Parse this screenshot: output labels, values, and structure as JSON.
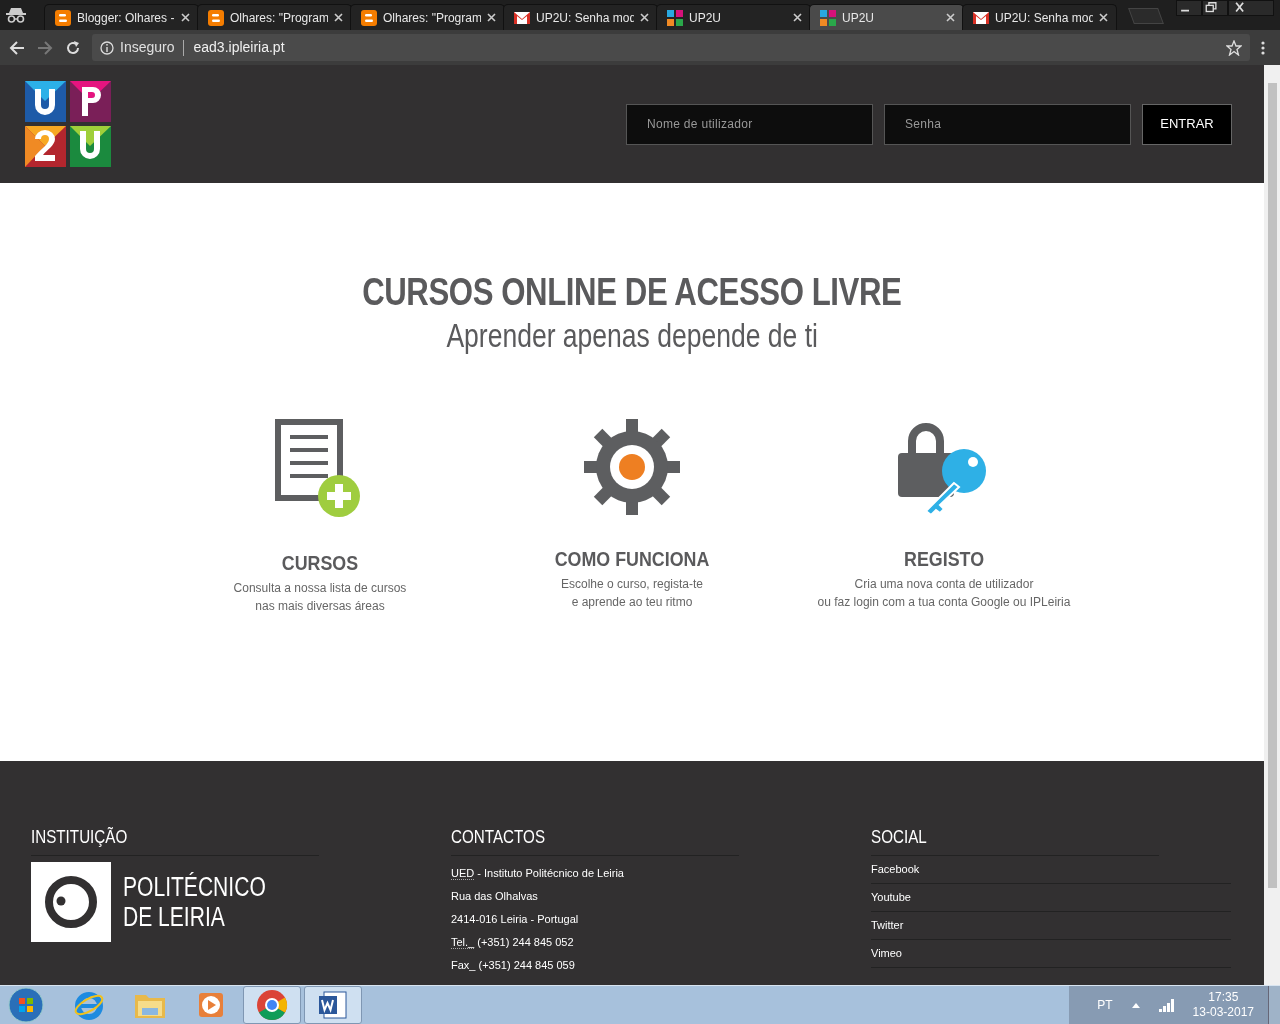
{
  "browser": {
    "tabs": [
      {
        "title": "Blogger: Olhares -",
        "kind": "blogger",
        "selected": false
      },
      {
        "title": "Olhares: \"Program",
        "kind": "blogger",
        "selected": false
      },
      {
        "title": "Olhares: \"Program",
        "kind": "blogger",
        "selected": false
      },
      {
        "title": "UP2U: Senha mod",
        "kind": "gmail",
        "selected": false
      },
      {
        "title": "UP2U",
        "kind": "up2u",
        "selected": false
      },
      {
        "title": "UP2U",
        "kind": "up2u",
        "selected": true
      },
      {
        "title": "UP2U: Senha mod",
        "kind": "gmail",
        "selected": false
      }
    ],
    "address": {
      "security": "Inseguro",
      "url": "ead3.ipleiria.pt"
    }
  },
  "header": {
    "login": {
      "username_placeholder": "Nome de utilizador",
      "password_placeholder": "Senha",
      "button": "ENTRAR"
    }
  },
  "hero": {
    "title": "CURSOS ONLINE DE ACESSO LIVRE",
    "subtitle": "Aprender apenas depende de ti"
  },
  "features": [
    {
      "kind": "document",
      "title": "CURSOS",
      "lines": [
        "Consulta a nossa lista de cursos",
        "nas mais diversas áreas"
      ]
    },
    {
      "kind": "gear",
      "title": "COMO FUNCIONA",
      "lines": [
        "Escolhe o curso, regista-te",
        "e aprende ao teu ritmo"
      ]
    },
    {
      "kind": "lock",
      "title": "REGISTO",
      "lines": [
        "Cria uma nova conta de utilizador",
        "ou faz login com a tua conta Google ou IPLeiria"
      ]
    }
  ],
  "footer": {
    "institution": {
      "heading": "INSTITUIÇÃO",
      "logo_lines": [
        "POLITÉCNICO",
        "DE LEIRIA"
      ]
    },
    "contacts": {
      "heading": "CONTACTOS",
      "lines": [
        {
          "abbr": "UED",
          "text": "- Instituto Politécnico de Leiria"
        },
        {
          "text": "Rua das Olhalvas"
        },
        {
          "text": "2414-016 Leiria - Portugal"
        },
        {
          "abbr": "Tel._",
          "text": "(+351) 244 845 052"
        },
        {
          "text": "Fax_ (+351) 244 845 059"
        }
      ]
    },
    "social": {
      "heading": "SOCIAL",
      "links": [
        "Facebook",
        "Youtube",
        "Twitter",
        "Vimeo"
      ]
    }
  },
  "taskbar": {
    "apps": [
      {
        "kind": "ie",
        "open": false
      },
      {
        "kind": "folder",
        "open": false
      },
      {
        "kind": "media",
        "open": false
      },
      {
        "kind": "chrome",
        "open": true
      },
      {
        "kind": "word",
        "open": true
      }
    ],
    "language": "PT",
    "time": "17:35",
    "date": "13-03-2017"
  }
}
